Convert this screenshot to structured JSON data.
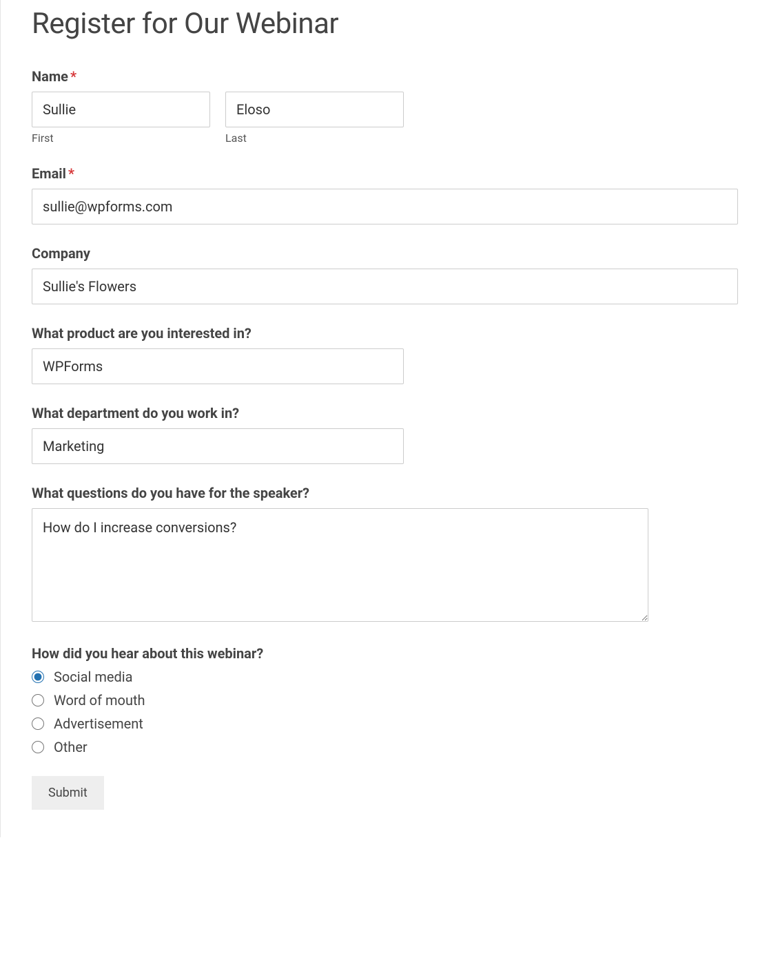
{
  "title": "Register for Our Webinar",
  "name": {
    "label": "Name",
    "required": "*",
    "first_value": "Sullie",
    "first_sublabel": "First",
    "last_value": "Eloso",
    "last_sublabel": "Last"
  },
  "email": {
    "label": "Email",
    "required": "*",
    "value": "sullie@wpforms.com"
  },
  "company": {
    "label": "Company",
    "value": "Sullie's Flowers"
  },
  "product": {
    "label": "What product are you interested in?",
    "selected": "WPForms"
  },
  "department": {
    "label": "What department do you work in?",
    "selected": "Marketing"
  },
  "questions": {
    "label": "What questions do you have for the speaker?",
    "value": "How do I increase conversions?"
  },
  "hear": {
    "label": "How did you hear about this webinar?",
    "options": [
      {
        "label": "Social media",
        "checked": true
      },
      {
        "label": "Word of mouth",
        "checked": false
      },
      {
        "label": "Advertisement",
        "checked": false
      },
      {
        "label": "Other",
        "checked": false
      }
    ]
  },
  "submit": "Submit"
}
